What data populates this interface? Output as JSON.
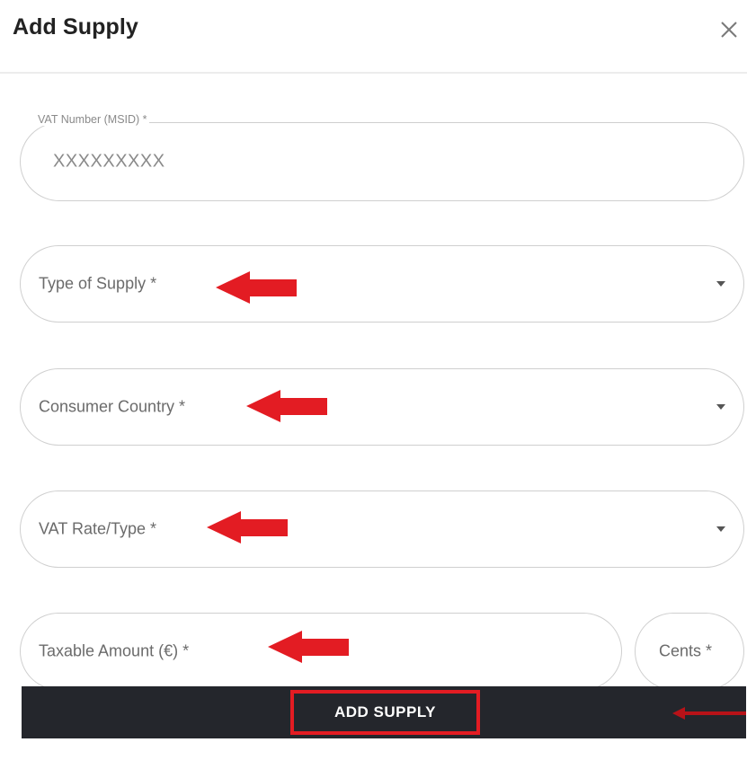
{
  "dialog": {
    "title": "Add Supply",
    "close_icon": "close-icon"
  },
  "fields": {
    "vat_number": {
      "label": "VAT Number (MSID) *",
      "value": "XXXXXXXXX"
    },
    "type_of_supply": {
      "placeholder": "Type of Supply *"
    },
    "consumer_country": {
      "placeholder": "Consumer Country *"
    },
    "vat_rate": {
      "placeholder": "VAT Rate/Type *"
    },
    "taxable_amount": {
      "placeholder": "Taxable Amount (€) *"
    },
    "cents": {
      "placeholder": "Cents *"
    }
  },
  "button": {
    "label": "ADD SUPPLY"
  },
  "colors": {
    "annotation_red": "#e31c23",
    "button_bg": "#24262c",
    "field_border": "#cfcfcf"
  }
}
